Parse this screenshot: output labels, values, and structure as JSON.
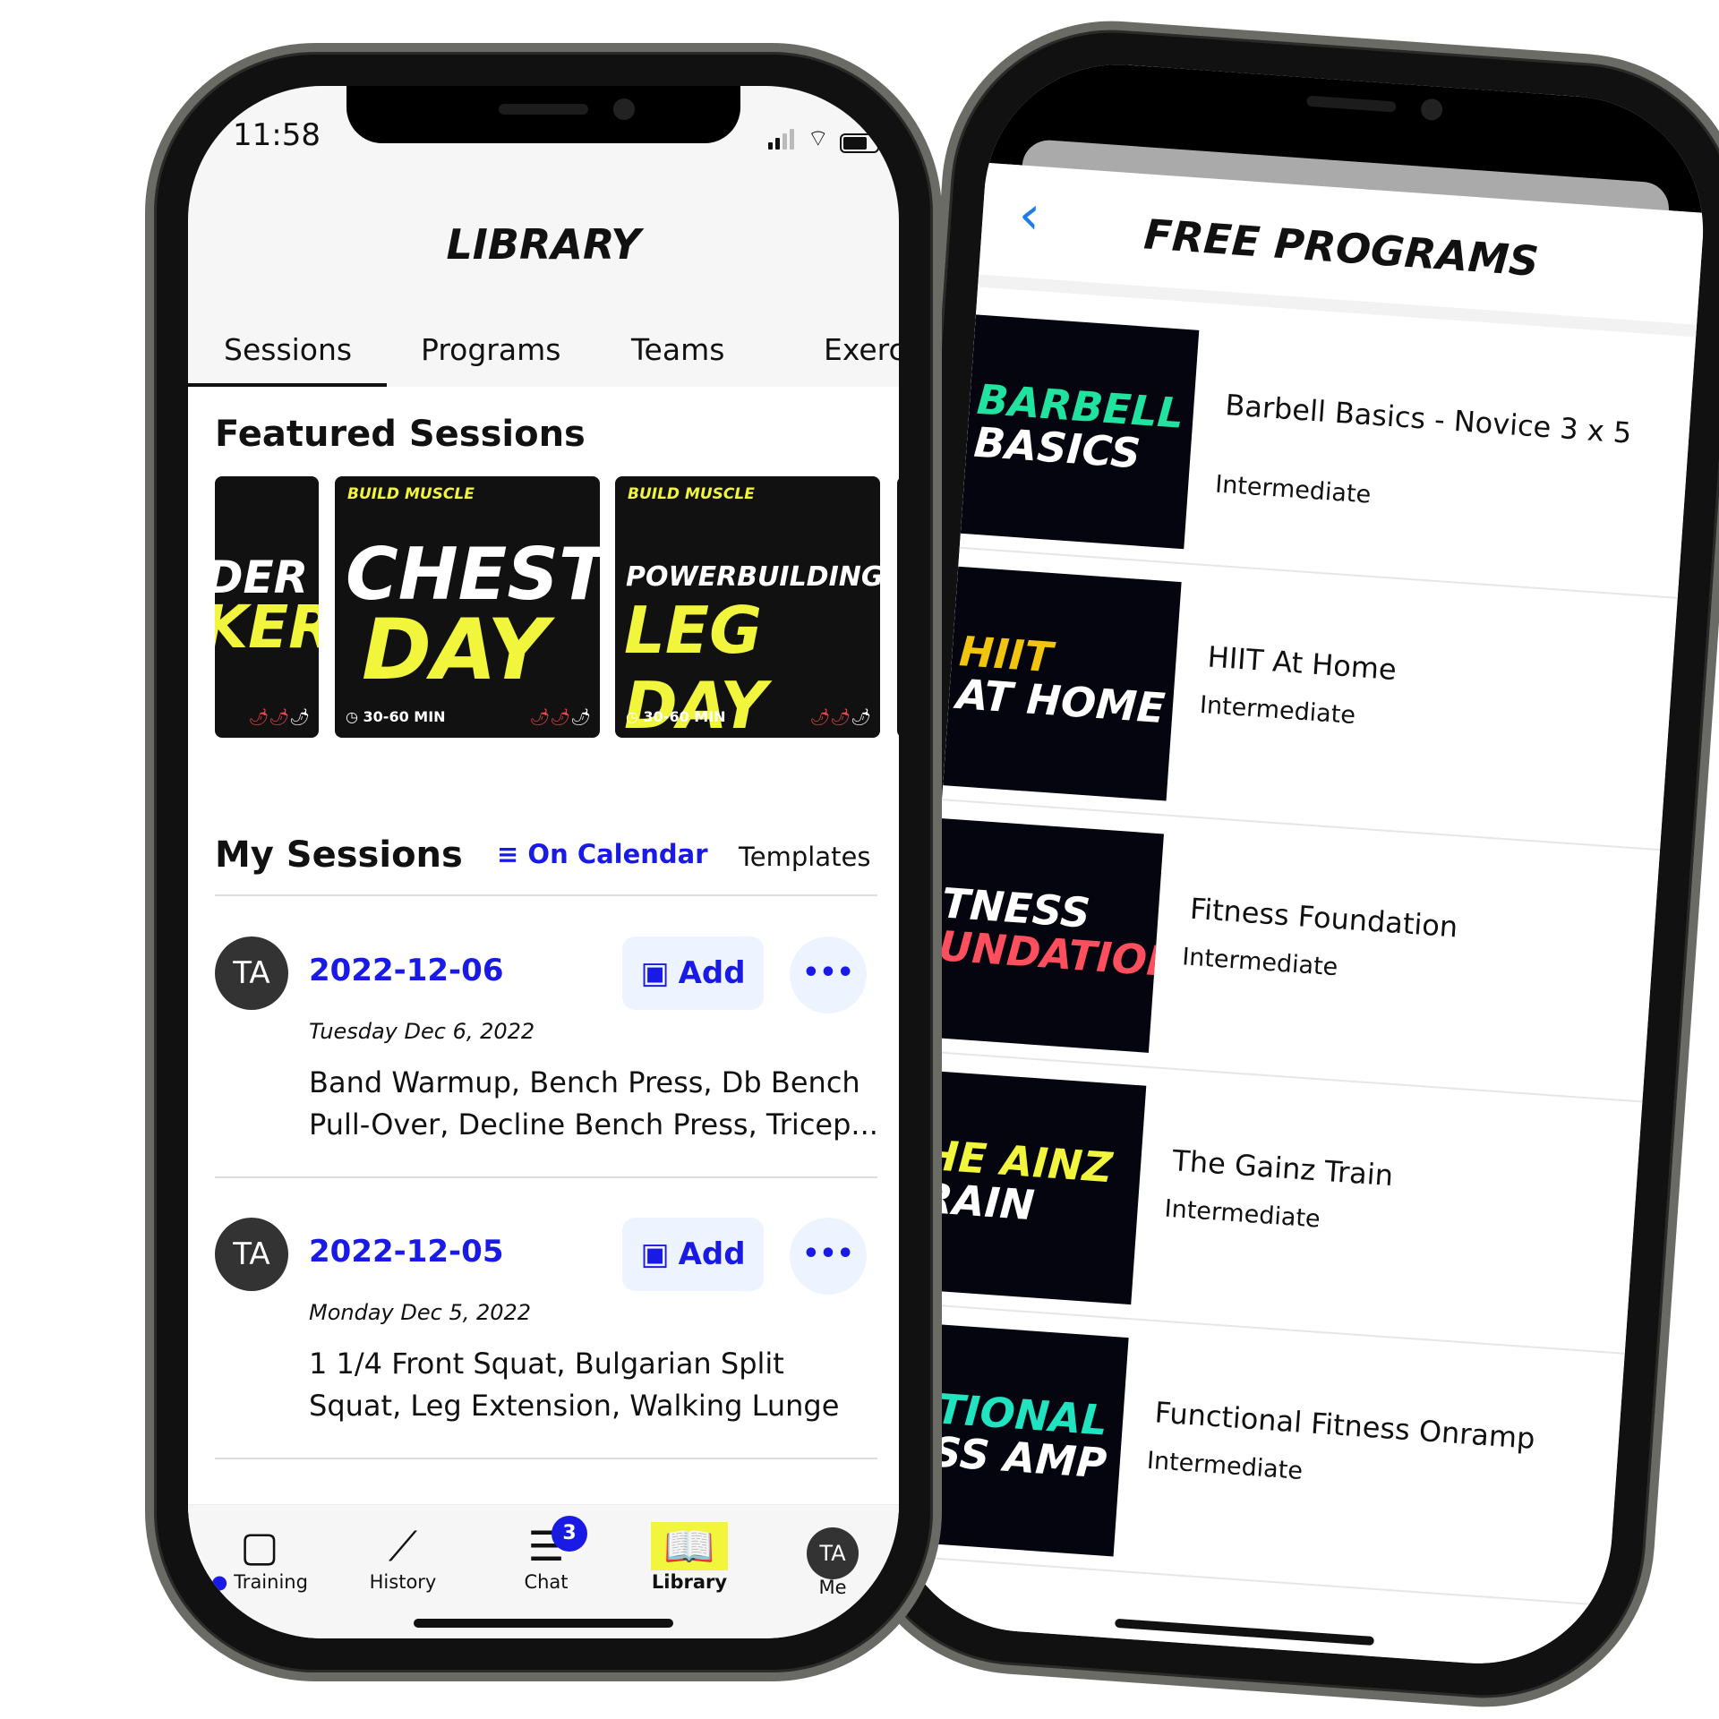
{
  "left_phone": {
    "status": {
      "time": "11:58"
    },
    "header": {
      "title": "LIBRARY"
    },
    "tabs": [
      {
        "label": "Sessions",
        "active": true
      },
      {
        "label": "Programs"
      },
      {
        "label": "Teams"
      },
      {
        "label": "Exerc"
      }
    ],
    "featured": {
      "heading": "Featured Sessions",
      "cards": [
        {
          "tag": "",
          "line1": "DER",
          "line2": "KER",
          "duration": "",
          "intensity": "2 of 3"
        },
        {
          "tag": "BUILD MUSCLE",
          "line1": "CHEST",
          "line2": "DAY",
          "duration": "30-60 MIN",
          "intensity": "2 of 3"
        },
        {
          "tag": "BUILD MUSCLE",
          "line1": "POWERBUILDING",
          "line2": "LEG DAY",
          "duration": "30-60 MIN",
          "intensity": "2 of 3"
        }
      ]
    },
    "my_sessions": {
      "heading": "My Sessions",
      "filter_label": "On Calendar",
      "templates_label": "Templates",
      "items": [
        {
          "avatar": "TA",
          "date": "2022-12-06",
          "add_label": "Add",
          "more": "•••",
          "day": "Tuesday Dec 6, 2022",
          "exercises": "Band Warmup, Bench Press, Db Bench Pull-Over, Decline Bench Press, Tricep..."
        },
        {
          "avatar": "TA",
          "date": "2022-12-05",
          "add_label": "Add",
          "more": "•••",
          "day": "Monday Dec 5, 2022",
          "exercises": "1 1/4 Front Squat, Bulgarian Split Squat, Leg Extension, Walking Lunge"
        }
      ]
    },
    "nav": [
      {
        "label": "Training",
        "icon": "calendar-icon"
      },
      {
        "label": "History",
        "icon": "barbell-icon"
      },
      {
        "label": "Chat",
        "icon": "chat-icon",
        "badge": "3"
      },
      {
        "label": "Library",
        "icon": "book-icon",
        "active": true
      },
      {
        "label": "Me",
        "icon": "avatar",
        "avatar": "TA"
      }
    ],
    "colors": {
      "accent": "#1a1ae6",
      "highlight": "#f1f53c"
    }
  },
  "right_phone": {
    "header": {
      "title": "FREE PROGRAMS",
      "back": "‹"
    },
    "programs": [
      {
        "thumb1": "BARBELL",
        "thumb2": "BASICS",
        "c1": "#20e3a0",
        "c2": "#ffffff",
        "name": "Barbell Basics - Novice 3 x 5",
        "level": "Intermediate"
      },
      {
        "thumb1": "HIIT",
        "thumb2": "AT HOME",
        "c1": "#f1c40f",
        "c2": "#ffffff",
        "name": "HIIT At Home",
        "level": "Intermediate"
      },
      {
        "thumb1": "TNESS",
        "thumb2": "UNDATION",
        "c1": "#ffffff",
        "c2": "#ff4f5e",
        "name": "Fitness Foundation",
        "level": "Intermediate"
      },
      {
        "thumb1": "HE AINZ",
        "thumb2": "RAIN",
        "c1": "#f1f53c",
        "c2": "#ffffff",
        "name": "The Gainz Train",
        "level": "Intermediate"
      },
      {
        "thumb1": "CTIONAL",
        "thumb2": "ESS AMP",
        "c1": "#20e3c0",
        "c2": "#ffffff",
        "name": "Functional Fitness Onramp",
        "level": "Intermediate"
      }
    ]
  }
}
